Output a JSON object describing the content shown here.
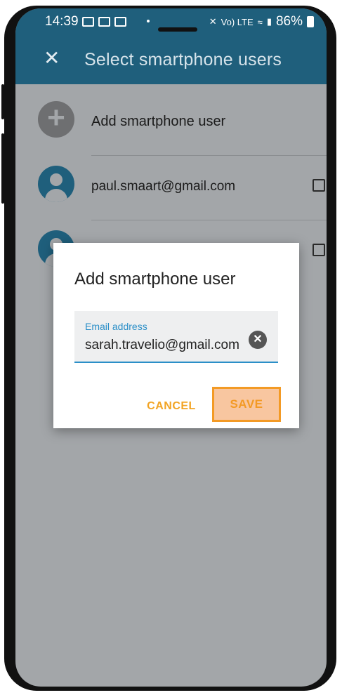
{
  "status_bar": {
    "time": "14:39",
    "battery": "86%",
    "network": "Vo) LTE"
  },
  "app_bar": {
    "title": "Select smartphone users",
    "close_icon": "close-icon"
  },
  "list": {
    "add_item": {
      "label": "Add smartphone user",
      "icon": "plus-icon"
    },
    "users": [
      {
        "email": "paul.smaart@gmail.com",
        "checked": false
      },
      {
        "email": "",
        "checked": false
      }
    ]
  },
  "dialog": {
    "title": "Add smartphone user",
    "field": {
      "label": "Email address",
      "value": "sarah.travelio@gmail.com"
    },
    "cancel_label": "CANCEL",
    "save_label": "SAVE"
  },
  "colors": {
    "app_bar": "#1f5f7c",
    "accent_orange": "#f39a25",
    "field_focus": "#2b8fc8",
    "scrim": "#a3a6a9"
  }
}
